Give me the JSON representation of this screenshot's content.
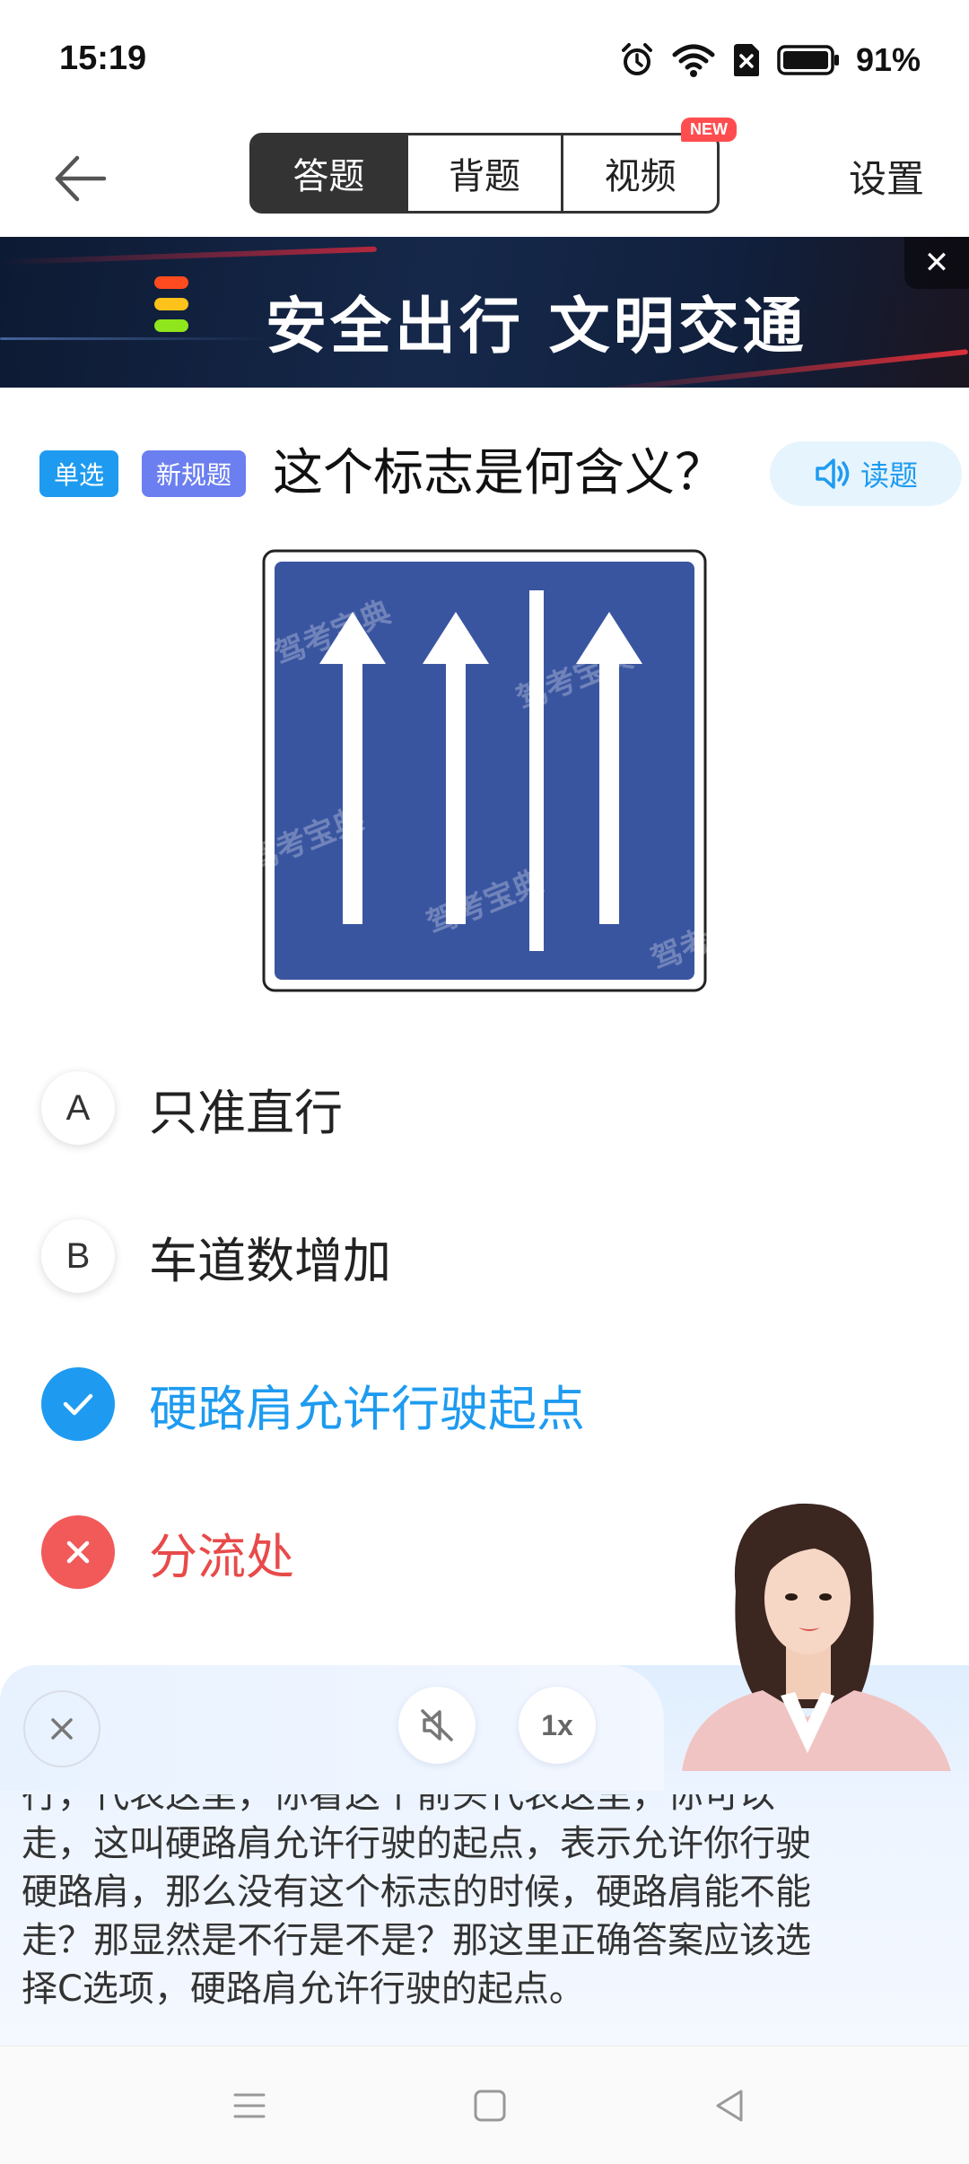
{
  "status_bar": {
    "time": "15:19",
    "battery_percent": "91%",
    "icons": [
      "alarm-icon",
      "wifi-icon",
      "no-sim-icon",
      "battery-icon"
    ]
  },
  "nav": {
    "back_icon": "back-arrow-icon",
    "tabs": [
      {
        "label": "答题",
        "active": true
      },
      {
        "label": "背题",
        "active": false
      },
      {
        "label": "视频",
        "active": false,
        "badge": "NEW"
      }
    ],
    "settings_label": "设置"
  },
  "banner": {
    "text": "安全出行 文明交通",
    "close_icon": "close-icon"
  },
  "question": {
    "tags": [
      "单选",
      "新规题"
    ],
    "text": "这个标志是何含义？",
    "read_label": "读题",
    "image_watermark": "驾考宝典"
  },
  "options": [
    {
      "letter": "A",
      "text": "只准直行",
      "state": "normal"
    },
    {
      "letter": "B",
      "text": "车道数增加",
      "state": "normal"
    },
    {
      "letter": "",
      "text": "硬路肩允许行驶起点",
      "state": "correct"
    },
    {
      "letter": "",
      "text": "分流处",
      "state": "wrong"
    }
  ],
  "explanation": {
    "speed_label": "1x",
    "lines": [
      "行，代表这里，你看这个前头代表这里，你可以",
      "走，这叫硬路肩允许行驶的起点，表示允许你行驶",
      "硬路肩，那么没有这个标志的时候，硬路肩能不能",
      "走？那显然是不行是不是？那这里正确答案应该选",
      "择C选项，硬路肩允许行驶的起点。"
    ]
  },
  "colors": {
    "accent": "#1e9bf0",
    "wrong": "#f25a5a",
    "sign_blue": "#3a55a0",
    "new_badge": "#ff4d4f"
  }
}
